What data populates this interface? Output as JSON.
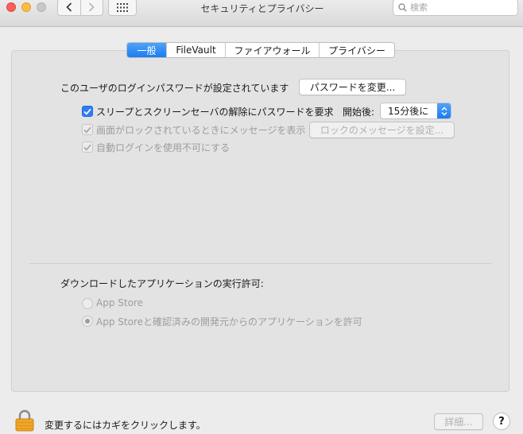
{
  "window": {
    "title": "セキュリティとプライバシー",
    "search_placeholder": "検索"
  },
  "tabs": [
    {
      "label": "一般",
      "active": true
    },
    {
      "label": "FileVault",
      "active": false
    },
    {
      "label": "ファイアウォール",
      "active": false
    },
    {
      "label": "プライバシー",
      "active": false
    }
  ],
  "general": {
    "login_password_text": "このユーザのログインパスワードが設定されています",
    "change_password_button": "パスワードを変更...",
    "require_password_label": "スリープとスクリーンセーバの解除にパスワードを要求",
    "start_after_label": "開始後:",
    "start_after_value": "15分後に",
    "show_message_label": "画面がロックされているときにメッセージを表示",
    "set_lock_message_button": "ロックのメッセージを設定...",
    "disable_autologin_label": "自動ログインを使用不可にする"
  },
  "downloads": {
    "heading": "ダウンロードしたアプリケーションの実行許可:",
    "option_app_store": "App Store",
    "option_app_store_identified": "App Storeと確認済みの開発元からのアプリケーションを許可"
  },
  "footer": {
    "lock_text": "変更するにはカギをクリックします。",
    "advanced_button": "詳細...",
    "help_label": "?"
  },
  "colors": {
    "accent": "#1d7cf2",
    "checkbox_blue": "#2f7df5"
  }
}
